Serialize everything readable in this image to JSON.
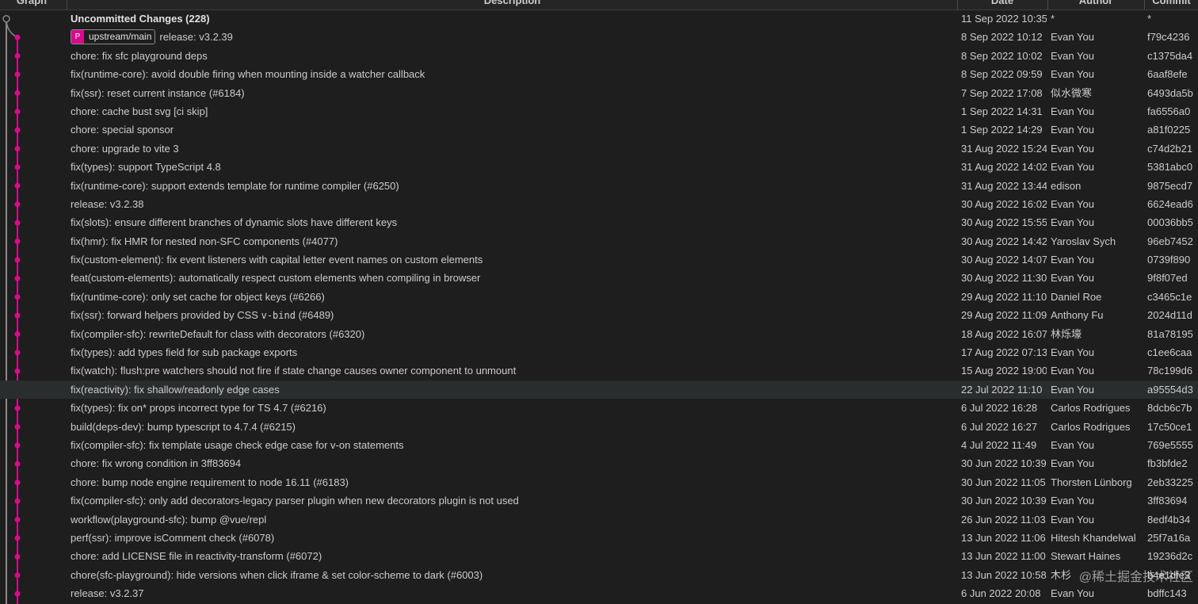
{
  "columns": {
    "graph": "Graph",
    "description": "Description",
    "date": "Date",
    "author": "Author",
    "commit": "Commit"
  },
  "colors": {
    "graph_line": "#d70b8c",
    "uncommitted_line": "#8a8a8a",
    "background": "#1e1e1e",
    "selected_row": "#2a2d2e"
  },
  "branch_tag": {
    "icon": "branch-icon",
    "icon_glyph": "P",
    "label": "upstream/main"
  },
  "commits": [
    {
      "description": "Uncommitted Changes (228)",
      "date": "11 Sep 2022 10:35",
      "author": "*",
      "commit": "*"
    },
    {
      "description": "release: v3.2.39",
      "date": "8 Sep 2022 10:12",
      "author": "Evan You",
      "commit": "f79c4236"
    },
    {
      "description": "chore: fix sfc playground deps",
      "date": "8 Sep 2022 10:02",
      "author": "Evan You",
      "commit": "c1375da4"
    },
    {
      "description": "fix(runtime-core): avoid double firing when mounting inside a watcher callback",
      "date": "8 Sep 2022 09:59",
      "author": "Evan You",
      "commit": "6aaf8efe"
    },
    {
      "description": "fix(ssr): reset current instance (#6184)",
      "date": "7 Sep 2022 17:08",
      "author": "似水微寒",
      "commit": "6493da5b"
    },
    {
      "description": "chore: cache bust svg [ci skip]",
      "date": "1 Sep 2022 14:31",
      "author": "Evan You",
      "commit": "fa6556a0"
    },
    {
      "description": "chore: special sponsor",
      "date": "1 Sep 2022 14:29",
      "author": "Evan You",
      "commit": "a81f0225"
    },
    {
      "description": "chore: upgrade to vite 3",
      "date": "31 Aug 2022 15:24",
      "author": "Evan You",
      "commit": "c74d2b21"
    },
    {
      "description": "fix(types): support TypeScript 4.8",
      "date": "31 Aug 2022 14:02",
      "author": "Evan You",
      "commit": "5381abc0"
    },
    {
      "description": "fix(runtime-core): support extends template for runtime compiler (#6250)",
      "date": "31 Aug 2022 13:44",
      "author": "edison",
      "commit": "9875ecd7"
    },
    {
      "description": "release: v3.2.38",
      "date": "30 Aug 2022 16:02",
      "author": "Evan You",
      "commit": "6624ead6"
    },
    {
      "description": "fix(slots): ensure different branches of dynamic slots have different keys",
      "date": "30 Aug 2022 15:55",
      "author": "Evan You",
      "commit": "00036bb5"
    },
    {
      "description": "fix(hmr): fix HMR for nested non-SFC components (#4077)",
      "date": "30 Aug 2022 14:42",
      "author": "Yaroslav Sych",
      "commit": "96eb7452"
    },
    {
      "description": "fix(custom-element): fix event listeners with capital letter event names on custom elements",
      "date": "30 Aug 2022 14:07",
      "author": "Evan You",
      "commit": "0739f890"
    },
    {
      "description": "feat(custom-elements): automatically respect custom elements when compiling in browser",
      "date": "30 Aug 2022 11:30",
      "author": "Evan You",
      "commit": "9f8f07ed"
    },
    {
      "description": "fix(runtime-core): only set cache for object keys (#6266)",
      "date": "29 Aug 2022 11:10",
      "author": "Daniel Roe",
      "commit": "c3465c1e"
    },
    {
      "description_prefix": "fix(ssr): forward helpers provided by CSS ",
      "description_code": "v-bind",
      "description_suffix": " (#6489)",
      "date": "29 Aug 2022 11:09",
      "author": "Anthony Fu",
      "commit": "2024d11d"
    },
    {
      "description": "fix(compiler-sfc): rewriteDefault for class with decorators (#6320)",
      "date": "18 Aug 2022 16:07",
      "author": "林烁壕",
      "commit": "81a78195"
    },
    {
      "description": "fix(types): add types field for sub package exports",
      "date": "17 Aug 2022 07:13",
      "author": "Evan You",
      "commit": "c1ee6caa"
    },
    {
      "description": "fix(watch): flush:pre watchers should not fire if state change causes owner component to unmount",
      "date": "15 Aug 2022 19:00",
      "author": "Evan You",
      "commit": "78c199d6"
    },
    {
      "description": "fix(reactivity): fix shallow/readonly edge cases",
      "date": "22 Jul 2022 11:10",
      "author": "Evan You",
      "commit": "a95554d3"
    },
    {
      "description": "fix(types): fix on* props incorrect type for TS 4.7 (#6216)",
      "date": "6 Jul 2022 16:28",
      "author": "Carlos Rodrigues",
      "commit": "8dcb6c7b"
    },
    {
      "description": "build(deps-dev): bump typescript to 4.7.4 (#6215)",
      "date": "6 Jul 2022 16:27",
      "author": "Carlos Rodrigues",
      "commit": "17c50ce1"
    },
    {
      "description": "fix(compiler-sfc): fix template usage check edge case for v-on statements",
      "date": "4 Jul 2022 11:49",
      "author": "Evan You",
      "commit": "769e5555"
    },
    {
      "description": "chore: fix wrong condition in 3ff83694",
      "date": "30 Jun 2022 10:39",
      "author": "Evan You",
      "commit": "fb3bfde2"
    },
    {
      "description": "chore: bump node engine requirement to node 16.11 (#6183)",
      "date": "30 Jun 2022 11:05",
      "author": "Thorsten Lünborg",
      "commit": "2eb33225"
    },
    {
      "description": "fix(compiler-sfc): only add decorators-legacy parser plugin when new decorators plugin is not used",
      "date": "30 Jun 2022 10:39",
      "author": "Evan You",
      "commit": "3ff83694"
    },
    {
      "description": "workflow(playground-sfc): bump @vue/repl",
      "date": "26 Jun 2022 11:03",
      "author": "Evan You",
      "commit": "8edf4b34"
    },
    {
      "description": "perf(ssr): improve isComment check (#6078)",
      "date": "13 Jun 2022 11:06",
      "author": "Hitesh Khandelwal",
      "commit": "25f7a16a"
    },
    {
      "description": "chore: add LICENSE file in reactivity-transform (#6072)",
      "date": "13 Jun 2022 11:00",
      "author": "Stewart Haines",
      "commit": "19236d2c"
    },
    {
      "description": "chore(sfc-playground): hide versions when click iframe & set color-scheme to dark (#6003)",
      "date": "13 Jun 2022 10:58",
      "author": "木杉",
      "commit": "b4e1dfe3"
    },
    {
      "description": "release: v3.2.37",
      "date": "6 Jun 2022 20:08",
      "author": "Evan You",
      "commit": "bdffc143"
    }
  ],
  "selected_index": 20,
  "watermark": "@稀土掘金技术社区"
}
